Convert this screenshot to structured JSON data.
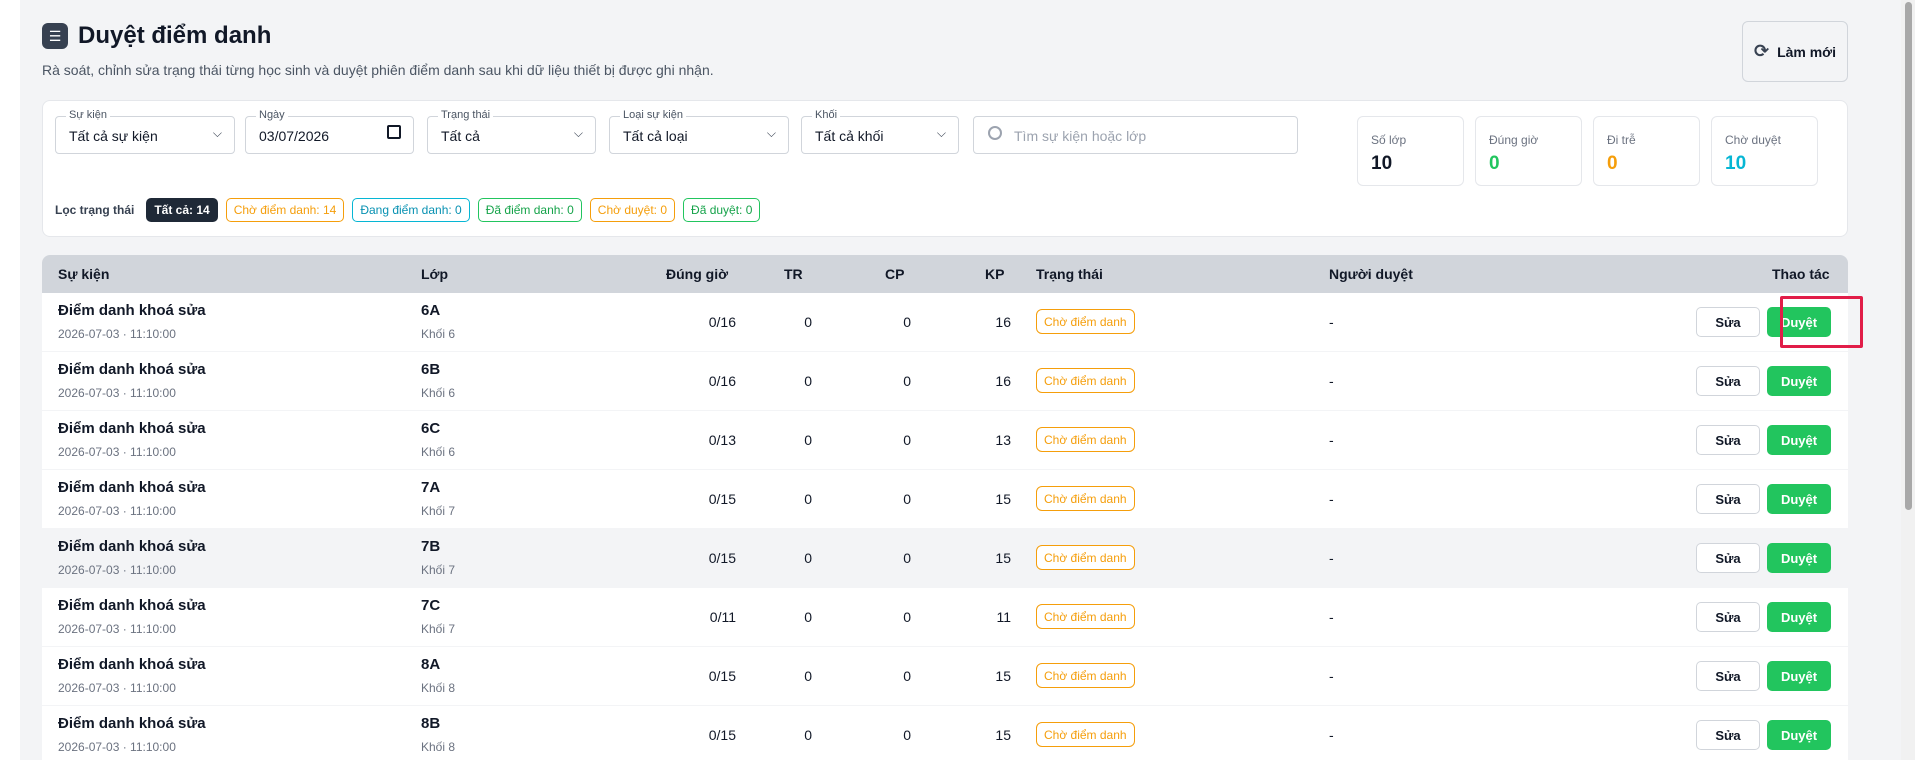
{
  "header": {
    "title": "Duyệt điểm danh",
    "subtitle": "Rà soát, chỉnh sửa trạng thái từng học sinh và duyệt phiên điểm danh sau khi dữ liệu thiết bị được ghi nhận.",
    "refresh_label": "Làm mới"
  },
  "filters": {
    "event": {
      "label": "Sự kiện",
      "value": "Tất cả sự kiện"
    },
    "date": {
      "label": "Ngày",
      "value": "03/07/2026"
    },
    "status": {
      "label": "Trạng thái",
      "value": "Tất cả"
    },
    "event_type": {
      "label": "Loại sự kiện",
      "value": "Tất cả loại"
    },
    "block": {
      "label": "Khối",
      "value": "Tất cả khối"
    },
    "search_placeholder": "Tìm sự kiện hoặc lớp"
  },
  "stats": [
    {
      "label": "Số lớp",
      "value": "10",
      "color": "#111827"
    },
    {
      "label": "Đúng giờ",
      "value": "0",
      "color": "#22c55e"
    },
    {
      "label": "Đi trễ",
      "value": "0",
      "color": "#f59e0b"
    },
    {
      "label": "Chờ duyệt",
      "value": "10",
      "color": "#06b6d4"
    }
  ],
  "status_filter": {
    "label": "Lọc trạng thái",
    "chips": [
      "Tất cả: 14",
      "Chờ điểm danh: 14",
      "Đang điểm danh: 0",
      "Đã điểm danh: 0",
      "Chờ duyệt: 0",
      "Đã duyệt: 0"
    ]
  },
  "table": {
    "columns": [
      "Sự kiện",
      "Lớp",
      "Đúng giờ",
      "TR",
      "CP",
      "KP",
      "Trạng thái",
      "Người duyệt",
      "Thao tác"
    ],
    "edit_label": "Sửa",
    "approve_label": "Duyệt",
    "rows": [
      {
        "event": "Điểm danh khoá sửa",
        "date": "2026-07-03 · 11:10:00",
        "cls": "6A",
        "grade": "Khối 6",
        "ontime": "0/16",
        "tr": "0",
        "cp": "0",
        "kp": "16",
        "status": "Chờ điểm danh",
        "reviewer": "-"
      },
      {
        "event": "Điểm danh khoá sửa",
        "date": "2026-07-03 · 11:10:00",
        "cls": "6B",
        "grade": "Khối 6",
        "ontime": "0/16",
        "tr": "0",
        "cp": "0",
        "kp": "16",
        "status": "Chờ điểm danh",
        "reviewer": "-"
      },
      {
        "event": "Điểm danh khoá sửa",
        "date": "2026-07-03 · 11:10:00",
        "cls": "6C",
        "grade": "Khối 6",
        "ontime": "0/13",
        "tr": "0",
        "cp": "0",
        "kp": "13",
        "status": "Chờ điểm danh",
        "reviewer": "-"
      },
      {
        "event": "Điểm danh khoá sửa",
        "date": "2026-07-03 · 11:10:00",
        "cls": "7A",
        "grade": "Khối 7",
        "ontime": "0/15",
        "tr": "0",
        "cp": "0",
        "kp": "15",
        "status": "Chờ điểm danh",
        "reviewer": "-"
      },
      {
        "event": "Điểm danh khoá sửa",
        "date": "2026-07-03 · 11:10:00",
        "cls": "7B",
        "grade": "Khối 7",
        "ontime": "0/15",
        "tr": "0",
        "cp": "0",
        "kp": "15",
        "status": "Chờ điểm danh",
        "reviewer": "-"
      },
      {
        "event": "Điểm danh khoá sửa",
        "date": "2026-07-03 · 11:10:00",
        "cls": "7C",
        "grade": "Khối 7",
        "ontime": "0/11",
        "tr": "0",
        "cp": "0",
        "kp": "11",
        "status": "Chờ điểm danh",
        "reviewer": "-"
      },
      {
        "event": "Điểm danh khoá sửa",
        "date": "2026-07-03 · 11:10:00",
        "cls": "8A",
        "grade": "Khối 8",
        "ontime": "0/15",
        "tr": "0",
        "cp": "0",
        "kp": "15",
        "status": "Chờ điểm danh",
        "reviewer": "-"
      },
      {
        "event": "Điểm danh khoá sửa",
        "date": "2026-07-03 · 11:10:00",
        "cls": "8B",
        "grade": "Khối 8",
        "ontime": "0/15",
        "tr": "0",
        "cp": "0",
        "kp": "15",
        "status": "Chờ điểm danh",
        "reviewer": "-"
      }
    ]
  }
}
